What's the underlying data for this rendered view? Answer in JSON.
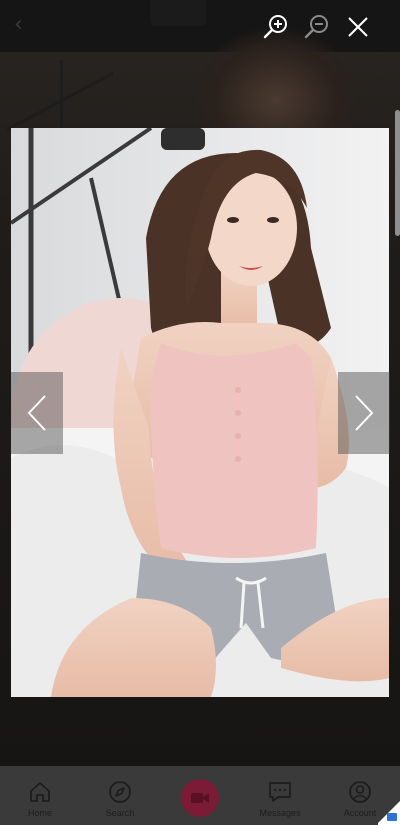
{
  "viewer": {
    "zoom_in_icon": "magnifier-plus-icon",
    "zoom_out_icon": "magnifier-minus-icon",
    "close_icon": "close-icon",
    "prev_icon": "chevron-left-icon",
    "next_icon": "chevron-right-icon"
  },
  "tabbar": {
    "items": [
      {
        "label": "Home",
        "icon": "home-icon"
      },
      {
        "label": "Search",
        "icon": "compass-icon"
      },
      {
        "label": "",
        "icon": "video-camera-icon",
        "accent": "#7b1b35"
      },
      {
        "label": "Messages",
        "icon": "chat-icon"
      },
      {
        "label": "Account",
        "icon": "user-icon"
      }
    ]
  },
  "colors": {
    "overlay": "#141414",
    "tabbar_bg": "#3a3a3a",
    "live_accent": "#7b1b35"
  }
}
